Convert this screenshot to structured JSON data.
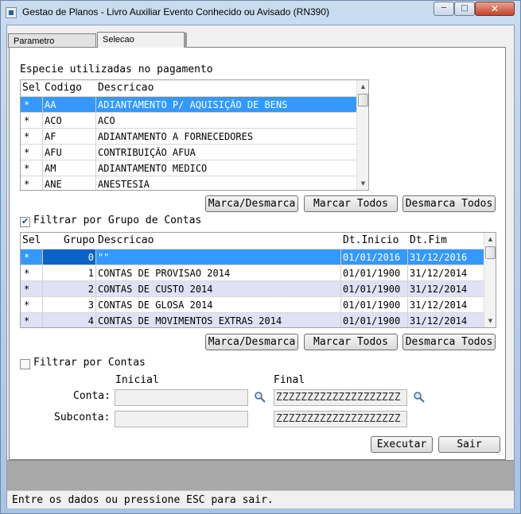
{
  "window": {
    "title": "Gestao de Planos - Livro Auxiliar Evento Conhecido ou Avisado (RN390)",
    "minimize_glyph": "─",
    "maximize_glyph": "□",
    "close_glyph": "✕"
  },
  "tabs": [
    {
      "label": "Parametro"
    },
    {
      "label": "Selecao"
    }
  ],
  "especie": {
    "label": "Especie utilizadas no pagamento",
    "columns": [
      "Sel",
      "Codigo",
      "Descricao"
    ],
    "rows": [
      {
        "sel": "*",
        "codigo": "AA",
        "descricao": "ADIANTAMENTO P/ AQUISIÇÃO DE BENS",
        "selected": true
      },
      {
        "sel": "*",
        "codigo": "ACO",
        "descricao": "ACO"
      },
      {
        "sel": "*",
        "codigo": "AF",
        "descricao": "ADIANTAMENTO A FORNECEDORES"
      },
      {
        "sel": "*",
        "codigo": "AFU",
        "descricao": "CONTRIBUIÇÃO AFUA"
      },
      {
        "sel": "*",
        "codigo": "AM",
        "descricao": "ADIANTAMENTO MEDICO"
      },
      {
        "sel": "*",
        "codigo": "ANE",
        "descricao": "ANESTESIA"
      }
    ],
    "buttons": {
      "marca": "Marca/Desmarca",
      "todos": "Marcar Todos",
      "desmarca": "Desmarca Todos"
    }
  },
  "grupo": {
    "checkbox_label": "Filtrar por Grupo de Contas",
    "checked": true,
    "columns": [
      "Sel",
      "Grupo",
      "Descricao",
      "Dt.Inicio",
      "Dt.Fim"
    ],
    "rows": [
      {
        "sel": "*",
        "grupo": "0",
        "descricao": "\"\"",
        "inicio": "01/01/2016",
        "fim": "31/12/2016",
        "selected": true
      },
      {
        "sel": "*",
        "grupo": "1",
        "descricao": "CONTAS DE PROVISAO 2014",
        "inicio": "01/01/1900",
        "fim": "31/12/2014"
      },
      {
        "sel": "*",
        "grupo": "2",
        "descricao": "CONTAS DE CUSTO 2014",
        "inicio": "01/01/1900",
        "fim": "31/12/2014"
      },
      {
        "sel": "*",
        "grupo": "3",
        "descricao": "CONTAS DE GLOSA 2014",
        "inicio": "01/01/1900",
        "fim": "31/12/2014"
      },
      {
        "sel": "*",
        "grupo": "4",
        "descricao": "CONTAS DE MOVIMENTOS EXTRAS 2014",
        "inicio": "01/01/1900",
        "fim": "31/12/2014"
      }
    ],
    "buttons": {
      "marca": "Marca/Desmarca",
      "todos": "Marcar Todos",
      "desmarca": "Desmarca Todos"
    }
  },
  "contas": {
    "checkbox_label": "Filtrar por Contas",
    "checked": false,
    "inicial_label": "Inicial",
    "final_label": "Final",
    "conta_label": "Conta:",
    "subconta_label": "Subconta:",
    "conta_inicial": "",
    "conta_final": "ZZZZZZZZZZZZZZZZZZZZ",
    "subconta_inicial": "",
    "subconta_final": "ZZZZZZZZZZZZZZZZZZZZ",
    "lookup_icon": "magnifier-icon"
  },
  "actions": {
    "executar": "Executar",
    "sair": "Sair"
  },
  "status": {
    "message": "Entre os dados ou pressione ESC para sair."
  }
}
